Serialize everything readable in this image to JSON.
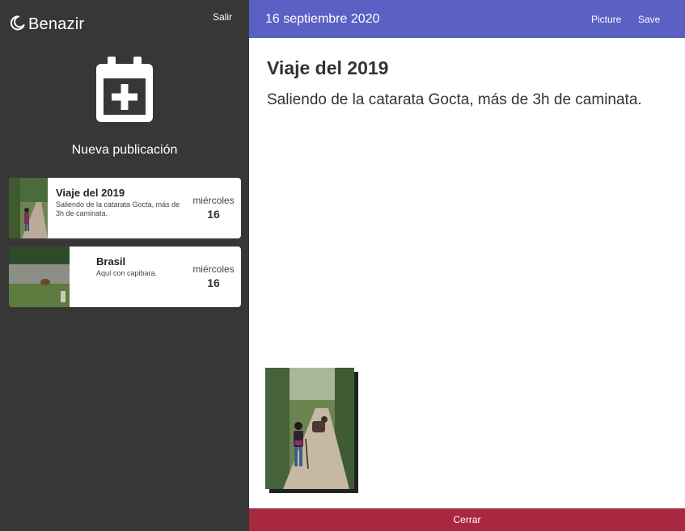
{
  "app": {
    "name": "Benazir",
    "logout_label": "Salir"
  },
  "sidebar": {
    "new_post_label": "Nueva publicación",
    "entries": [
      {
        "title": "Viaje del 2019",
        "excerpt": "Saliendo de la catarata Gocta, más de 3h de caminata.",
        "weekday": "miércoles",
        "day": "16"
      },
      {
        "title": "Brasil",
        "excerpt": "Aquí con capibara.",
        "weekday": "miércoles",
        "day": "16"
      }
    ]
  },
  "topbar": {
    "date": "16 septiembre 2020",
    "picture_label": "Picture",
    "save_label": "Save"
  },
  "entry": {
    "title": "Viaje del 2019",
    "body": "Saliendo de la catarata Gocta, más de 3h de caminata."
  },
  "footer": {
    "close_label": "Cerrar"
  },
  "colors": {
    "sidebar_bg": "#373737",
    "topbar_bg": "#5b60c4",
    "close_bg": "#a8283f",
    "card_bg": "#ffffff"
  },
  "icons": {
    "brand": "crescent-moon-icon",
    "new_post": "calendar-plus-icon"
  }
}
